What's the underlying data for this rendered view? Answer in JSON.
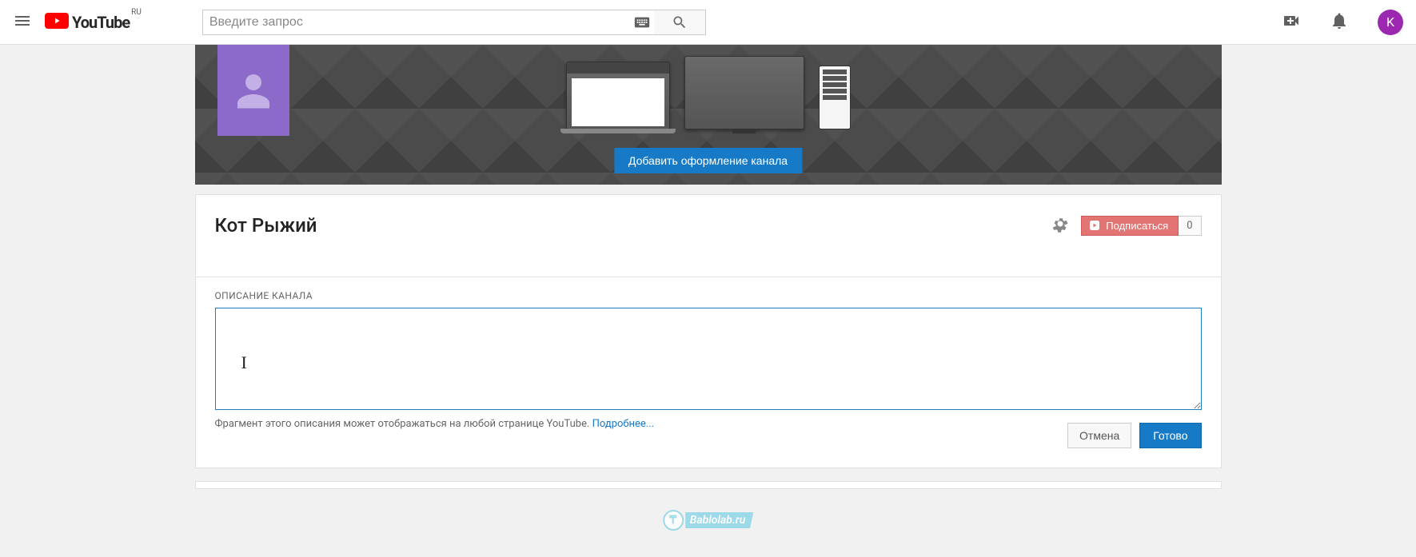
{
  "header": {
    "logo_text": "YouTube",
    "logo_region": "RU",
    "search_placeholder": "Введите запрос",
    "avatar_letter": "K"
  },
  "banner": {
    "add_art_label": "Добавить оформление канала"
  },
  "channel": {
    "name": "Кот Рыжий",
    "subscribe_label": "Подписаться",
    "subscriber_count": "0"
  },
  "form": {
    "label": "ОПИСАНИЕ КАНАЛА",
    "value": "",
    "help_text": "Фрагмент этого описания может отображаться на любой странице YouTube. ",
    "help_link": "Подробнее...",
    "cancel_label": "Отмена",
    "done_label": "Готово"
  },
  "watermark": {
    "text": "Bablolab.ru",
    "badge": "₸"
  }
}
